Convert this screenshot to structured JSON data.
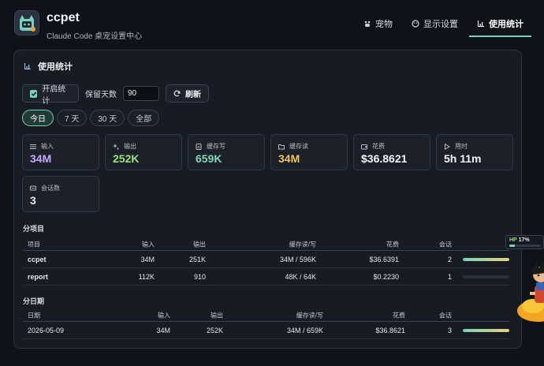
{
  "app": {
    "title": "ccpet",
    "subtitle": "Claude Code 桌宠设置中心"
  },
  "tabs": [
    {
      "label": "宠物",
      "icon": "pet-icon"
    },
    {
      "label": "显示设置",
      "icon": "palette-icon"
    },
    {
      "label": "使用统计",
      "icon": "chart-icon",
      "active": true
    }
  ],
  "panel": {
    "title": "使用统计"
  },
  "controls": {
    "enable_label": "开启统计",
    "enable_checked": true,
    "days_label": "保留天数",
    "days_value": "90",
    "refresh_label": "刷新"
  },
  "ranges": [
    {
      "label": "今日",
      "active": true
    },
    {
      "label": "7 天"
    },
    {
      "label": "30 天"
    },
    {
      "label": "全部"
    }
  ],
  "stats": [
    {
      "label": "输入",
      "value": "34M",
      "icon": "list-icon",
      "color": "#8fd0ff"
    },
    {
      "label": "输出",
      "value": "252K",
      "icon": "sparkle-icon",
      "color": "#c9a7ff"
    },
    {
      "label": "缓存写",
      "value": "659K",
      "icon": "document-icon",
      "color": "#9be37d"
    },
    {
      "label": "缓存读",
      "value": "34M",
      "icon": "folder-icon",
      "color": "#7fd6b3"
    },
    {
      "label": "花费",
      "value": "$36.8621",
      "icon": "wallet-icon",
      "color": "#f0c65a"
    },
    {
      "label": "用时",
      "value": "5h 11m",
      "icon": "play-icon",
      "color": "#f2f4f7"
    },
    {
      "label": "会话数",
      "value": "3",
      "icon": "chat-icon",
      "color": "#f2f4f7"
    }
  ],
  "by_project": {
    "title": "分项目",
    "headers": [
      "项目",
      "输入",
      "输出",
      "缓存读/写",
      "花费",
      "会话"
    ],
    "rows": [
      {
        "name": "ccpet",
        "input": "34M",
        "output": "251K",
        "cache": "34M / 596K",
        "cost": "$36.6391",
        "sessions": "2",
        "share": 1.0
      },
      {
        "name": "report",
        "input": "112K",
        "output": "910",
        "cache": "48K / 64K",
        "cost": "$0.2230",
        "sessions": "1",
        "share": 0.006
      }
    ]
  },
  "by_date": {
    "title": "分日期",
    "headers": [
      "日期",
      "输入",
      "输出",
      "缓存读/写",
      "花费",
      "会话"
    ],
    "rows": [
      {
        "date": "2026-05-09",
        "input": "34M",
        "output": "252K",
        "cache": "34M / 659K",
        "cost": "$36.8621",
        "sessions": "3",
        "share": 1.0
      }
    ]
  },
  "hp": {
    "label": "HP",
    "value": "17%",
    "fraction": 0.17,
    "label_color": "#8fe36b"
  },
  "colors": {
    "accent": "#7ad0b9",
    "background": "#0f1218",
    "panel": "#171b23"
  }
}
